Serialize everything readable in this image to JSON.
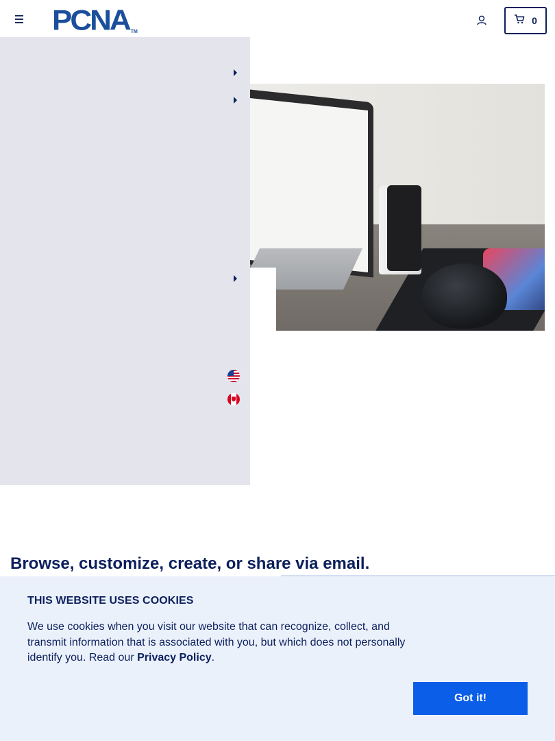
{
  "header": {
    "logo_text": "PCNA",
    "logo_tm": "TM",
    "cart_count": "0",
    "menu_icon": "hamburger-menu-icon",
    "user_icon": "user-icon",
    "cart_icon": "cart-icon"
  },
  "side_panel": {
    "arrows": [
      "chevron-right-icon",
      "chevron-right-icon",
      "chevron-right-icon"
    ],
    "flags": [
      "us-flag-icon",
      "canada-flag-icon"
    ]
  },
  "main": {
    "tagline": "Browse, customize, create, or share via email."
  },
  "cookie_banner": {
    "title": "THIS WEBSITE USES COOKIES",
    "text_before_link": "We use cookies when you visit our website that can recognize, collect, and transmit information that is associated with you, but which does not personally identify you. Read our ",
    "link_label": "Privacy Policy",
    "text_after_link": ".",
    "button_label": "Got it!"
  },
  "colors": {
    "navy": "#0b1f5c",
    "brand_blue": "#1b4f9c",
    "button_blue": "#0a5ee8",
    "panel_bg": "#e4e5ec",
    "cookie_bg": "#ebf1fb"
  }
}
